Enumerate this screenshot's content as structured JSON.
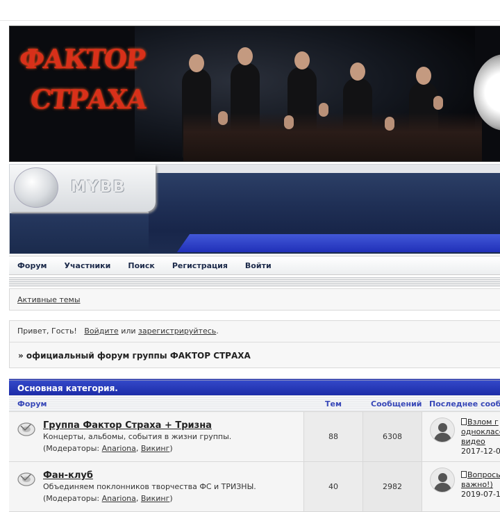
{
  "banner": {
    "logo_line1": "ФАКТОР",
    "logo_line2": "СТРАХА"
  },
  "skin": {
    "brand": "MYBB"
  },
  "nav": {
    "items": [
      "Форум",
      "Участники",
      "Поиск",
      "Регистрация",
      "Войти"
    ]
  },
  "active_topics_link": "Активные темы",
  "welcome": {
    "greeting": "Привет, Гость!",
    "login_link": "Войдите",
    "or_text": "или",
    "register_link": "зарегистрируйтесь",
    "period": ".",
    "forum_title": "» официальный форум группы ФАКТОР СТРАХА"
  },
  "category": {
    "title": "Основная категория."
  },
  "columns": {
    "forum": "Форум",
    "topics": "Тем",
    "posts": "Сообщений",
    "last_post": "Последнее сооб"
  },
  "forums": [
    {
      "title": "Группа Фактор Страха + Тризна",
      "description": "Концерты, альбомы, события в жизни группы.",
      "mods_prefix": "(Модераторы:",
      "mods": [
        "Anariona",
        "Викинг"
      ],
      "mods_suffix": ")",
      "topics": "88",
      "posts": "6308",
      "last_line1": "Взлом г",
      "last_line2": "однокласс",
      "last_line3": "видео",
      "last_date": "2017-12-0"
    },
    {
      "title": "Фан-клуб",
      "description": "Объединяем поклонников творчества ФС и ТРИЗНЫ.",
      "mods_prefix": "(Модераторы:",
      "mods": [
        "Anariona",
        "Викинг"
      ],
      "mods_suffix": ")",
      "topics": "40",
      "posts": "2982",
      "last_line1": "Вопросы",
      "last_line2": "важно!)",
      "last_date": "2019-07-1"
    }
  ],
  "colors": {
    "accent_blue": "#2030b8",
    "header_text": "#3848b8"
  }
}
